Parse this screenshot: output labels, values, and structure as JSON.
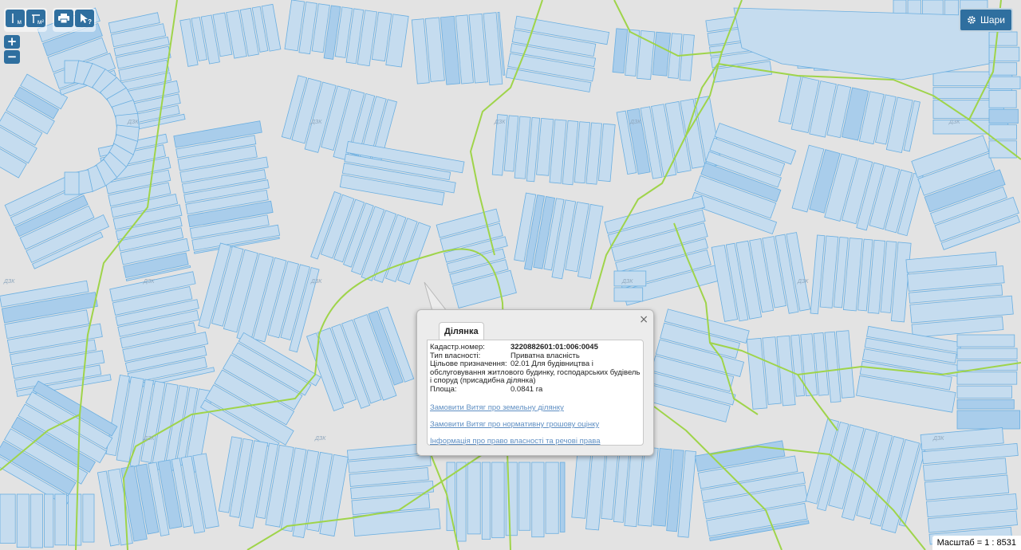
{
  "toolbar": {
    "measure_length_icon": "ruler-line-icon",
    "measure_length_sub": "м",
    "measure_area_icon": "ruler-area-icon",
    "measure_area_sub": "м²",
    "print_icon": "printer-icon",
    "info_icon": "cursor-question-icon",
    "info_sub": "?"
  },
  "zoom": {
    "in_label": "+",
    "out_label": "−"
  },
  "layers": {
    "label": "Шари",
    "icon": "gear-icon"
  },
  "scale": {
    "text": "Масштаб = 1 : 8531"
  },
  "map_labels": [
    "ДЗК",
    "ДЗК",
    "ДЗК",
    "ДЗК",
    "ДЗК",
    "ДЗК",
    "ДЗК",
    "ДЗК",
    "ДЗК",
    "ДЗК",
    "ДЗК",
    "ДЗК",
    "ДЗК"
  ],
  "popup": {
    "close_label": "×",
    "tab_label": "Ділянка",
    "cadastral_label": "Кадастр.номер:",
    "cadastral_value": "3220882601:01:006:0045",
    "ownership_label": "Тип власності:",
    "ownership_value": "Приватна власність",
    "purpose_label": "Цільове призначення:",
    "purpose_value": "02.01 Для будівництва і",
    "purpose_continued": "обслуговування житлового будинку, господарських будівель і споруд (присадибна ділянка)",
    "area_label": "Площа:",
    "area_value": "0.0841 га",
    "link_extract_land": "Замовити Витяг про земельну ділянку",
    "link_extract_valuation": "Замовити Витяг про нормативну грошову оцінку",
    "link_ownership_info": "Інформація про право власності та речові права"
  },
  "colors": {
    "background": "#e3e3e3",
    "parcel_fill": "#c5dcef",
    "parcel_stroke": "#6aaee0",
    "boundary_green": "#9fd44a",
    "toolbar_blue": "#2f6f9f",
    "link_blue": "#5f8fc3"
  }
}
